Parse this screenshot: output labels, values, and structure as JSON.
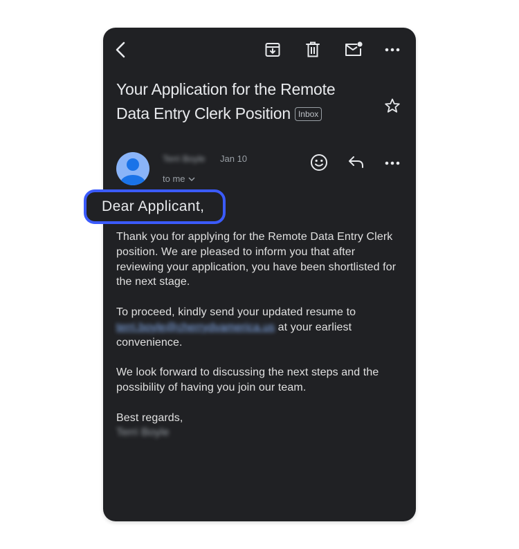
{
  "toolbar": {
    "back_icon": "arrow-left-icon",
    "archive_icon": "archive-icon",
    "delete_icon": "trash-icon",
    "mark_unread_icon": "mail-unread-icon",
    "more_icon": "more-horizontal-icon"
  },
  "email": {
    "subject": "Your Application for the Remote Data Entry Clerk Position",
    "label_chip": "Inbox",
    "starred": false,
    "sender": {
      "name": "Terri Boyle",
      "date": "Jan 10",
      "recipient": "to me"
    },
    "greeting": "Dear Applicant,",
    "body": {
      "p1": "Thank you for applying for the Remote Data Entry Clerk position. We are pleased to inform you that after reviewing your application, you have been shortlisted for the next stage.",
      "p2_before": "To proceed, kindly send your updated resume to ",
      "p2_link": "terri.boyle@cherrydvamerica.us",
      "p2_after": " at your earliest convenience.",
      "p3": "We look forward to discussing the next steps and the possibility of having you join our team.",
      "closing": "Best regards,",
      "signature": "Terri Boyle"
    }
  },
  "colors": {
    "background": "#202124",
    "highlight_border": "#3b5bfd",
    "avatar": "#8ab4f8",
    "link": "#8ab4f8"
  }
}
